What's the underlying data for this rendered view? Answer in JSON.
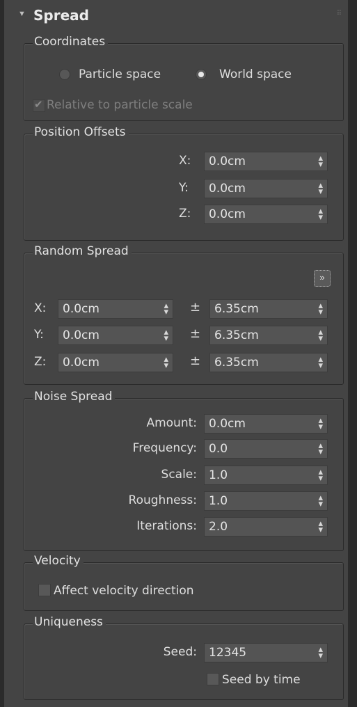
{
  "rollout": {
    "title": "Spread"
  },
  "coordinates": {
    "legend": "Coordinates",
    "options": [
      "Particle space",
      "World space"
    ],
    "selected": "World space",
    "relative_label": "Relative to particle scale",
    "relative_checked": true,
    "relative_enabled": false
  },
  "position_offsets": {
    "legend": "Position Offsets",
    "x_label": "X:",
    "x_value": "0.0cm",
    "y_label": "Y:",
    "y_value": "0.0cm",
    "z_label": "Z:",
    "z_value": "0.0cm"
  },
  "random_spread": {
    "legend": "Random Spread",
    "more_button": "»",
    "pm": "±",
    "rows": [
      {
        "label": "X:",
        "value": "0.0cm",
        "range": "6.35cm"
      },
      {
        "label": "Y:",
        "value": "0.0cm",
        "range": "6.35cm"
      },
      {
        "label": "Z:",
        "value": "0.0cm",
        "range": "6.35cm"
      }
    ]
  },
  "noise_spread": {
    "legend": "Noise Spread",
    "amount_label": "Amount:",
    "amount_value": "0.0cm",
    "frequency_label": "Frequency:",
    "frequency_value": "0.0",
    "scale_label": "Scale:",
    "scale_value": "1.0",
    "roughness_label": "Roughness:",
    "roughness_value": "1.0",
    "iterations_label": "Iterations:",
    "iterations_value": "2.0"
  },
  "velocity": {
    "legend": "Velocity",
    "affect_label": "Affect velocity direction",
    "affect_checked": false
  },
  "uniqueness": {
    "legend": "Uniqueness",
    "seed_label": "Seed:",
    "seed_value": "12345",
    "seed_by_time_label": "Seed by time",
    "seed_by_time_checked": false
  },
  "icons": {
    "collapse": "triangle-down-icon",
    "grip": "grip-dots-icon",
    "spinner": "spinner-arrows-icon"
  },
  "colors": {
    "panel_bg": "#444444",
    "field_bg": "#545454",
    "text": "#dcdcdc",
    "border": "#2a2a2a"
  }
}
